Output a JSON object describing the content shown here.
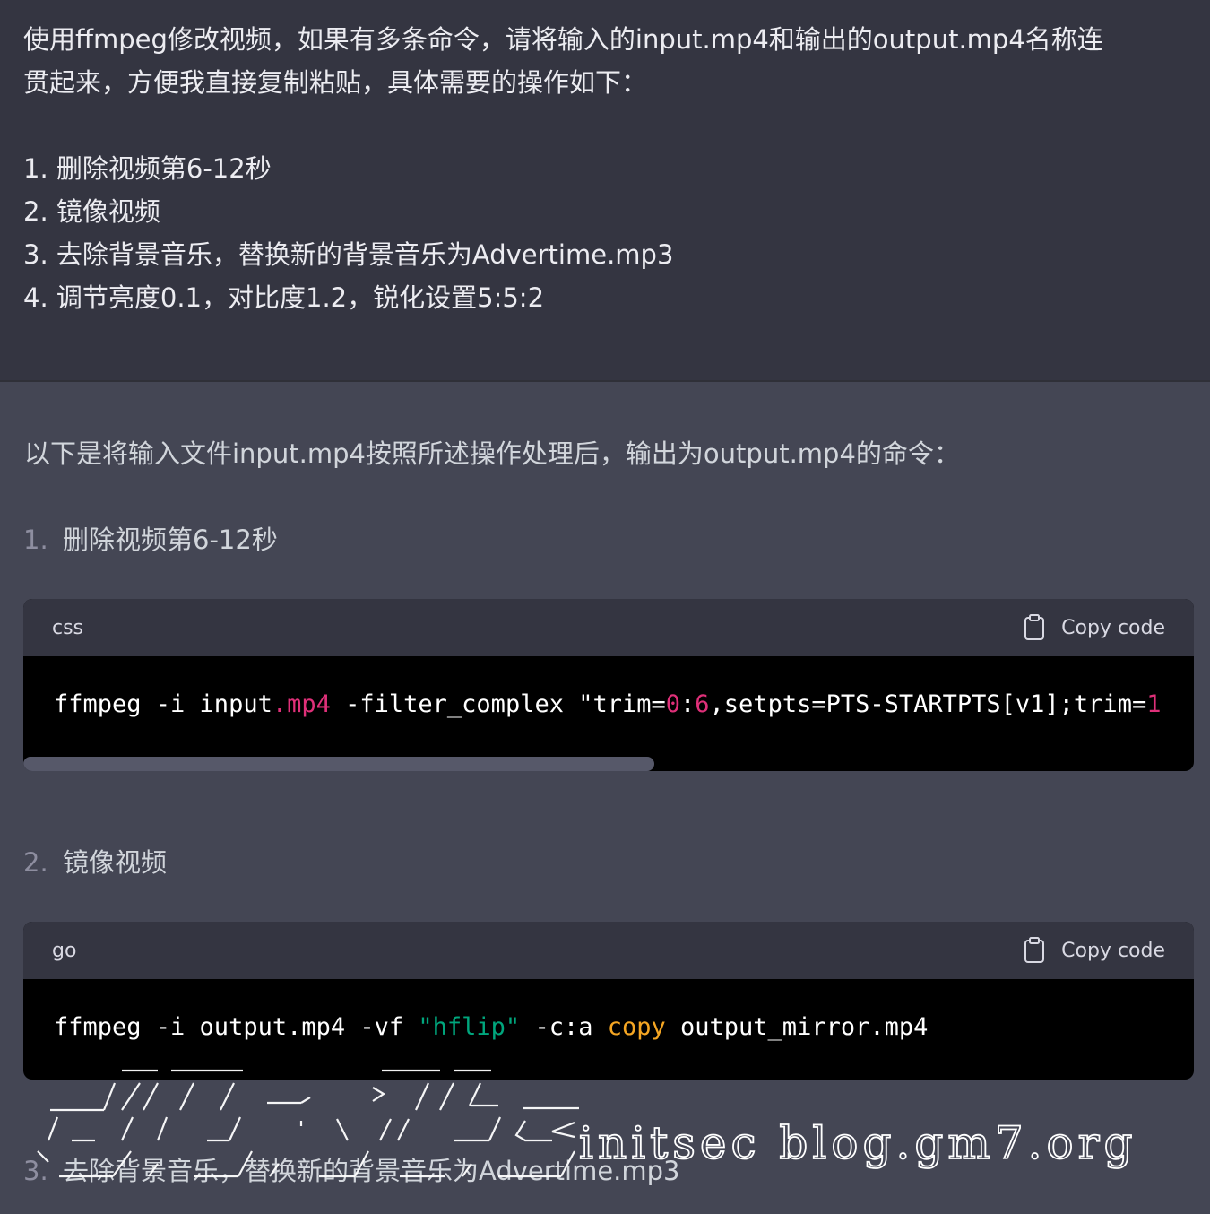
{
  "user_message": {
    "line1": "使用ffmpeg修改视频，如果有多条命令，请将输入的input.mp4和输出的output.mp4名称连",
    "line2": "贯起来，方便我直接复制粘贴，具体需要的操作如下：",
    "items": [
      "1. 删除视频第6-12秒",
      "2. 镜像视频",
      "3. 去除背景音乐，替换新的背景音乐为Advertime.mp3",
      "4. 调节亮度0.1，对比度1.2，锐化设置5:5:2"
    ]
  },
  "assistant": {
    "intro": "以下是将输入文件input.mp4按照所述操作处理后，输出为output.mp4的命令：",
    "steps": [
      {
        "num": "1.",
        "label": "删除视频第6-12秒"
      },
      {
        "num": "2.",
        "label": "镜像视频"
      },
      {
        "num": "3.",
        "label": "去除背景音乐，替换新的背景音乐为Advertime.mp3"
      }
    ],
    "code_blocks": [
      {
        "lang": "css",
        "copy_label": "Copy code",
        "tokens": [
          "ffmpeg -i input",
          ".mp4",
          " -filter_complex \"trim=",
          "0",
          ":",
          "6",
          ",setpts=PTS-STARTPTS[v1];trim=",
          "1"
        ]
      },
      {
        "lang": "go",
        "copy_label": "Copy code",
        "tokens": [
          "ffmpeg -i output.mp4 -vf ",
          "\"hflip\"",
          " -c:a ",
          "copy",
          " output_mirror.mp4"
        ]
      }
    ]
  },
  "watermark": {
    "text": "initsec blog.gm7.org"
  },
  "colors": {
    "user_bg": "#343541",
    "assistant_bg": "#444654",
    "code_bg": "#000000",
    "code_header_bg": "#343541",
    "token_red": "#df3079",
    "token_green": "#00a67d",
    "token_orange": "#f5a623"
  }
}
